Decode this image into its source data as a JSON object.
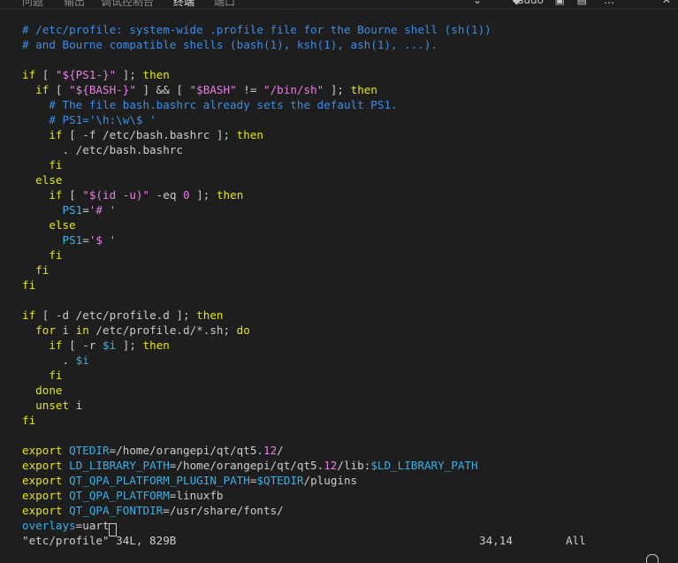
{
  "top_tabs": [
    "问题",
    "输出",
    "调试控制台",
    "终端",
    "端口"
  ],
  "active_tab_index": 3,
  "top_right": {
    "shell_label": "sudo"
  },
  "lines": [
    [
      [
        "c",
        "# /etc/profile: system-wide .profile file for the Bourne shell (sh(1))"
      ]
    ],
    [
      [
        "c",
        "# and Bourne compatible shells (bash(1), ksh(1), ash(1), ...)."
      ]
    ],
    [],
    [
      [
        "k",
        "if"
      ],
      [
        "d",
        " [ "
      ],
      [
        "s",
        "\"${PS1-}\""
      ],
      [
        "d",
        " ]; "
      ],
      [
        "k",
        "then"
      ]
    ],
    [
      [
        "d",
        "  "
      ],
      [
        "k",
        "if"
      ],
      [
        "d",
        " [ "
      ],
      [
        "s",
        "\"${BASH-}\""
      ],
      [
        "d",
        " ] && [ "
      ],
      [
        "s",
        "\"$BASH\""
      ],
      [
        "d",
        " != "
      ],
      [
        "s",
        "\"/bin/sh\""
      ],
      [
        "d",
        " ]; "
      ],
      [
        "k",
        "then"
      ]
    ],
    [
      [
        "d",
        "    "
      ],
      [
        "c",
        "# The file bash.bashrc already sets the default PS1."
      ]
    ],
    [
      [
        "d",
        "    "
      ],
      [
        "c",
        "# PS1='\\h:\\w\\$ '"
      ]
    ],
    [
      [
        "d",
        "    "
      ],
      [
        "k",
        "if"
      ],
      [
        "d",
        " [ -f /etc/bash.bashrc ]; "
      ],
      [
        "k",
        "then"
      ]
    ],
    [
      [
        "d",
        "      . /etc/bash.bashrc"
      ]
    ],
    [
      [
        "d",
        "    "
      ],
      [
        "k",
        "fi"
      ]
    ],
    [
      [
        "d",
        "  "
      ],
      [
        "k",
        "else"
      ]
    ],
    [
      [
        "d",
        "    "
      ],
      [
        "k",
        "if"
      ],
      [
        "d",
        " [ "
      ],
      [
        "s",
        "\"$(id -u)\""
      ],
      [
        "d",
        " -eq "
      ],
      [
        "n",
        "0"
      ],
      [
        "d",
        " ]; "
      ],
      [
        "k",
        "then"
      ]
    ],
    [
      [
        "d",
        "      "
      ],
      [
        "v",
        "PS1"
      ],
      [
        "d",
        "="
      ],
      [
        "s",
        "'# '"
      ]
    ],
    [
      [
        "d",
        "    "
      ],
      [
        "k",
        "else"
      ]
    ],
    [
      [
        "d",
        "      "
      ],
      [
        "v",
        "PS1"
      ],
      [
        "d",
        "="
      ],
      [
        "s",
        "'$ '"
      ]
    ],
    [
      [
        "d",
        "    "
      ],
      [
        "k",
        "fi"
      ]
    ],
    [
      [
        "d",
        "  "
      ],
      [
        "k",
        "fi"
      ]
    ],
    [
      [
        "k",
        "fi"
      ]
    ],
    [],
    [
      [
        "k",
        "if"
      ],
      [
        "d",
        " [ -d /etc/profile.d ]; "
      ],
      [
        "k",
        "then"
      ]
    ],
    [
      [
        "d",
        "  "
      ],
      [
        "k",
        "for"
      ],
      [
        "d",
        " i "
      ],
      [
        "k",
        "in"
      ],
      [
        "d",
        " /etc/profile.d/*.sh; "
      ],
      [
        "k",
        "do"
      ]
    ],
    [
      [
        "d",
        "    "
      ],
      [
        "k",
        "if"
      ],
      [
        "d",
        " [ -r "
      ],
      [
        "v",
        "$i"
      ],
      [
        "d",
        " ]; "
      ],
      [
        "k",
        "then"
      ]
    ],
    [
      [
        "d",
        "      . "
      ],
      [
        "v",
        "$i"
      ]
    ],
    [
      [
        "d",
        "    "
      ],
      [
        "k",
        "fi"
      ]
    ],
    [
      [
        "d",
        "  "
      ],
      [
        "k",
        "done"
      ]
    ],
    [
      [
        "d",
        "  "
      ],
      [
        "k",
        "unset"
      ],
      [
        "d",
        " i"
      ]
    ],
    [
      [
        "k",
        "fi"
      ]
    ],
    [],
    [
      [
        "k",
        "export"
      ],
      [
        "d",
        " "
      ],
      [
        "v",
        "QTEDIR"
      ],
      [
        "d",
        "=/home/orangepi/qt/qt5."
      ],
      [
        "n",
        "12"
      ],
      [
        "d",
        "/"
      ]
    ],
    [
      [
        "k",
        "export"
      ],
      [
        "d",
        " "
      ],
      [
        "v",
        "LD_LIBRARY_PATH"
      ],
      [
        "d",
        "=/home/orangepi/qt/qt5."
      ],
      [
        "n",
        "12"
      ],
      [
        "d",
        "/lib:"
      ],
      [
        "v",
        "$LD_LIBRARY_PATH"
      ]
    ],
    [
      [
        "k",
        "export"
      ],
      [
        "d",
        " "
      ],
      [
        "v",
        "QT_QPA_PLATFORM_PLUGIN_PATH"
      ],
      [
        "d",
        "="
      ],
      [
        "v",
        "$QTEDIR"
      ],
      [
        "d",
        "/plugins"
      ]
    ],
    [
      [
        "k",
        "export"
      ],
      [
        "d",
        " "
      ],
      [
        "v",
        "QT_QPA_PLATFORM"
      ],
      [
        "d",
        "=linuxfb"
      ]
    ],
    [
      [
        "k",
        "export"
      ],
      [
        "d",
        " "
      ],
      [
        "v",
        "QT_QPA_FONTDIR"
      ],
      [
        "d",
        "=/usr/share/fonts/"
      ]
    ],
    [
      [
        "v",
        "overlays"
      ],
      [
        "d",
        "=uart"
      ],
      [
        "cursor",
        "3"
      ]
    ]
  ],
  "status": {
    "file": "\"etc/profile\" 34L, 829B",
    "position": "34,14",
    "scroll": "All"
  }
}
